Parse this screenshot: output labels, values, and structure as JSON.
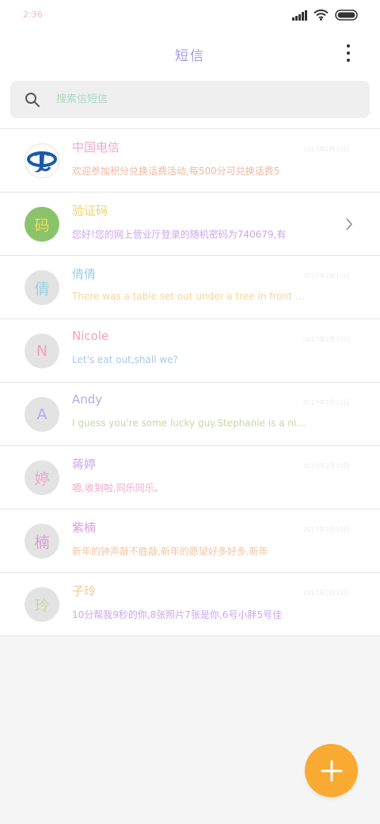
{
  "status_bar": {
    "time": "2:36",
    "icons": [
      "signal-icon",
      "wifi-icon",
      "battery-icon"
    ]
  },
  "header": {
    "title": "短信",
    "more_icon": "more-vert-icon"
  },
  "search": {
    "placeholder": "搜索信短信",
    "icon": "search-icon"
  },
  "conversations": [
    {
      "name": "中国电信",
      "date": "2017年2月10日",
      "message": "欢迎参加积分兑换话费活动,每500分可兑换话费5",
      "avatar": "telecom-logo"
    },
    {
      "name": "验证码",
      "date": "",
      "message": "您好!您的网上营业厅登录的随机密码为740679,有",
      "avatar_text": "码"
    },
    {
      "name": "倩倩",
      "date": "2017年2月10日",
      "message": "There was a table set out under a tree in front of the",
      "avatar_text": "倩"
    },
    {
      "name": "Nicole",
      "date": "2017年2月10日",
      "message": "Let's eat out,shall we?",
      "avatar_text": "N"
    },
    {
      "name": "Andy",
      "date": "2017年2月10日",
      "message": "I guess you're some lucky guy.Stephanie is a nice girl.",
      "avatar_text": "A"
    },
    {
      "name": "蒋婷",
      "date": "2017年2月10日",
      "message": "嗯,收到啦,同乐同乐。",
      "avatar_text": "婷"
    },
    {
      "name": "紫楠",
      "date": "2017年2月10日",
      "message": "新年的钟声敲不胜敲,新年的愿望好多好多,新年",
      "avatar_text": "楠"
    },
    {
      "name": "子玲",
      "date": "2017年2月10日",
      "message": "10分帮我9秒的你,8张照片7张是你,6号小胖5号佳",
      "avatar_text": "玲"
    }
  ],
  "fab": {
    "icon": "plus-icon"
  },
  "colors": {
    "fab": "#f8aa32",
    "telecom_blue": "#1a5aa8",
    "code_avatar": "#8ac46a"
  }
}
